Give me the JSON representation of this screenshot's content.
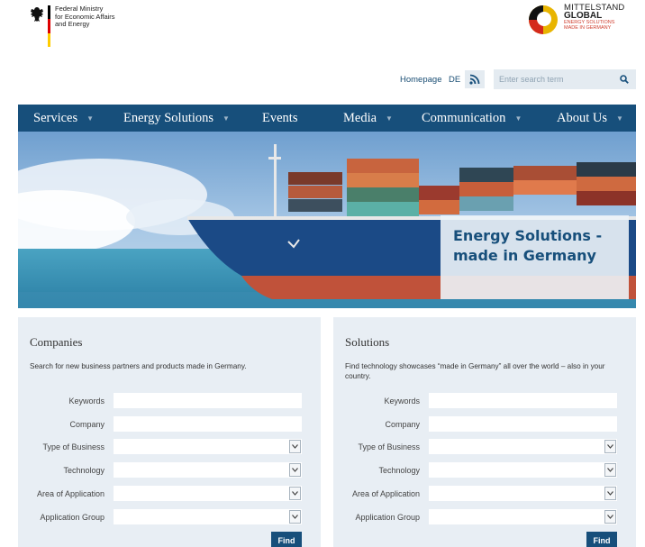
{
  "header": {
    "ministry_lines": [
      "Federal Ministry",
      "for Economic Affairs",
      "and Energy"
    ],
    "mg_lines": [
      "MITTELSTAND",
      "GLOBAL",
      "ENERGY SOLUTIONS",
      "MADE IN GERMANY"
    ]
  },
  "utility": {
    "homepage": "Homepage",
    "lang": "DE",
    "search_placeholder": "Enter search term"
  },
  "nav": {
    "items": [
      {
        "label": "Services",
        "caret": true
      },
      {
        "label": "Energy Solutions",
        "caret": true
      },
      {
        "label": "Events",
        "caret": false
      },
      {
        "label": "Media",
        "caret": true
      },
      {
        "label": "Communication",
        "caret": true
      },
      {
        "label": "About Us",
        "caret": true
      }
    ]
  },
  "hero": {
    "title_line1": "Energy Solutions -",
    "title_line2": "made in Germany"
  },
  "companies": {
    "title": "Companies",
    "description": "Search for new business partners and products made in Germany.",
    "labels": [
      "Keywords",
      "Company",
      "Type of Business",
      "Technology",
      "Area of Application",
      "Application Group"
    ],
    "find": "Find"
  },
  "solutions": {
    "title": "Solutions",
    "description": "Find technology showcases “made in Germany” all over the world – also in your country.",
    "labels": [
      "Keywords",
      "Company",
      "Type of Business",
      "Technology",
      "Area of Application",
      "Application Group"
    ],
    "find": "Find"
  },
  "colors": {
    "nav": "#174f7b",
    "panel": "#e8eef4",
    "link": "#1a4e74"
  },
  "icons": [
    "federal-eagle-icon",
    "mittelstand-global-logo-icon",
    "rss-icon",
    "search-icon",
    "chevron-down-icon"
  ]
}
